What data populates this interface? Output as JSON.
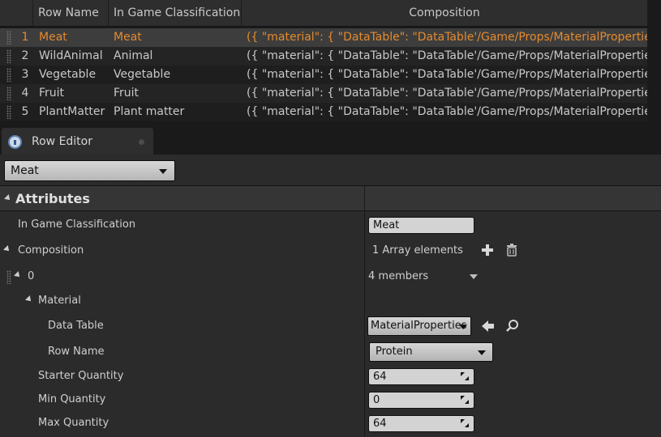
{
  "table": {
    "headers": {
      "row_name": "Row Name",
      "classification": "In Game Classification",
      "composition": "Composition"
    },
    "rows": [
      {
        "num": "1",
        "name": "Meat",
        "classification": "Meat",
        "composition": "({ \"material\": { \"DataTable\": \"DataTable'/Game/Props/MaterialProperties.MaterialProperties'\", \"RowName\": \"Protein\" }"
      },
      {
        "num": "2",
        "name": "WildAnimal",
        "classification": "Animal",
        "composition": "({ \"material\": { \"DataTable\": \"DataTable'/Game/Props/MaterialProperties.MaterialProperties'\", \"RowName\": \"Protein\" }"
      },
      {
        "num": "3",
        "name": "Vegetable",
        "classification": "Vegetable",
        "composition": "({ \"material\": { \"DataTable\": \"DataTable'/Game/Props/MaterialProperties.MaterialProperties'\", \"RowName\": \"Fiber\" }"
      },
      {
        "num": "4",
        "name": "Fruit",
        "classification": "Fruit",
        "composition": "({ \"material\": { \"DataTable\": \"DataTable'/Game/Props/MaterialProperties.MaterialProperties'\", \"RowName\": \"Sugar\" }"
      },
      {
        "num": "5",
        "name": "PlantMatter",
        "classification": "Plant matter",
        "composition": "({ \"material\": { \"DataTable\": \"DataTable'/Game/Props/MaterialProperties.MaterialProperties'\", \"RowName\": \"Fiber\" }"
      }
    ],
    "selected_index": 0,
    "selected_color": "#e48a2e"
  },
  "row_editor": {
    "tab_label": "Row Editor",
    "tab_icon": "magnifier-info-icon",
    "row_selector_value": "Meat",
    "category_title": "Attributes",
    "props": {
      "in_game_classification": {
        "label": "In Game Classification",
        "value": "Meat"
      },
      "composition": {
        "label": "Composition",
        "value": "1 Array elements"
      },
      "element_0": {
        "label": "0",
        "value": "4 members"
      },
      "material": {
        "label": "Material"
      },
      "data_table": {
        "label": "Data Table",
        "value": "MaterialProperties"
      },
      "row_name": {
        "label": "Row Name",
        "value": "Protein"
      },
      "starter_quantity": {
        "label": "Starter Quantity",
        "value": "64"
      },
      "min_quantity": {
        "label": "Min Quantity",
        "value": "0"
      },
      "max_quantity": {
        "label": "Max Quantity",
        "value": "64"
      }
    }
  }
}
